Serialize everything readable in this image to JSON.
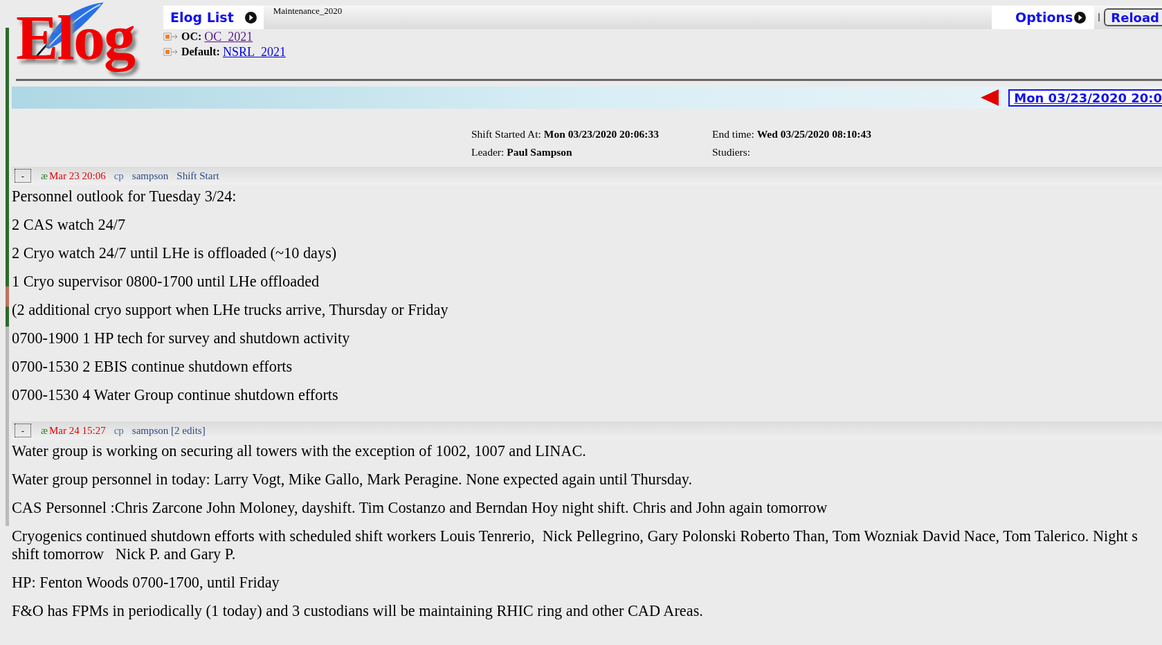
{
  "header": {
    "logo": "Elog",
    "elog_list_tab": "Elog List",
    "logbook_name": "Maintenance_2020",
    "options": "Options",
    "reload": "Reload",
    "links": [
      {
        "label": "OC:",
        "link": "OC_2021",
        "visited": true
      },
      {
        "label": "Default:",
        "link": "NSRL_2021",
        "visited": false
      }
    ]
  },
  "nav": {
    "date": "Mon 03/23/2020 20:0"
  },
  "shift": [
    {
      "label": "Shift Started At:",
      "value": "Mon 03/23/2020 20:06:33"
    },
    {
      "label": "End time:",
      "value": "Wed 03/25/2020 08:10:43"
    },
    {
      "label": "Leader:",
      "value": "Paul Sampson"
    },
    {
      "label": "Studiers:"
    }
  ],
  "entries": [
    {
      "collapse": "-",
      "icon": "æ",
      "time": "Mar 23 20:06",
      "initials": "cp",
      "author": "sampson",
      "title": "Shift Start",
      "paragraphs": [
        [
          "Personnel outlook for Tuesday 3/24:"
        ],
        [
          "2 CAS watch 24/7"
        ],
        [
          "2 Cryo watch 24/7 until LHe is offloaded (~10 days)"
        ],
        [
          "1 Cryo supervisor 0800-1700 until LHe offloaded"
        ],
        [
          "(2 additional cryo support when LHe trucks arrive, Thursday or Friday"
        ],
        [
          "0700-1900 1 HP tech for survey and shutdown activity"
        ],
        [
          "0700-1530 2 EBIS continue shutdown efforts"
        ],
        [
          "0700-1530 4 Water Group continue shutdown efforts"
        ]
      ]
    },
    {
      "collapse": "-",
      "icon": "æ",
      "time": "Mar 24 15:27",
      "initials": "cp",
      "author": "sampson [2 edits]",
      "paragraphs": [
        [
          "Water group is working on securing all towers with the exception of 1002, 1007 and LINAC."
        ],
        [
          "Water group personnel in today: Larry Vogt, Mike Gallo, Mark Peragine. None expected again until Thursday."
        ],
        [
          "CAS Personnel :Chris Zarcone John Moloney, dayshift. Tim Costanzo and Berndan Hoy night shift. Chris and John again tomorrow"
        ],
        [
          "Cryogenics continued shutdown efforts with scheduled shift workers Louis Tenrerio,  Nick Pellegrino, Gary Polonski Roberto Than, Tom Wozniak David Nace, Tom Talerico. Night s",
          "shift tomorrow   Nick P. and Gary P."
        ],
        [
          "HP: Fenton Woods 0700-1700, until Friday"
        ],
        [
          "F&O has FPMs in periodically (1 today) and 3 custodians will be maintaining RHIC ring and other CAD Areas."
        ]
      ]
    }
  ]
}
